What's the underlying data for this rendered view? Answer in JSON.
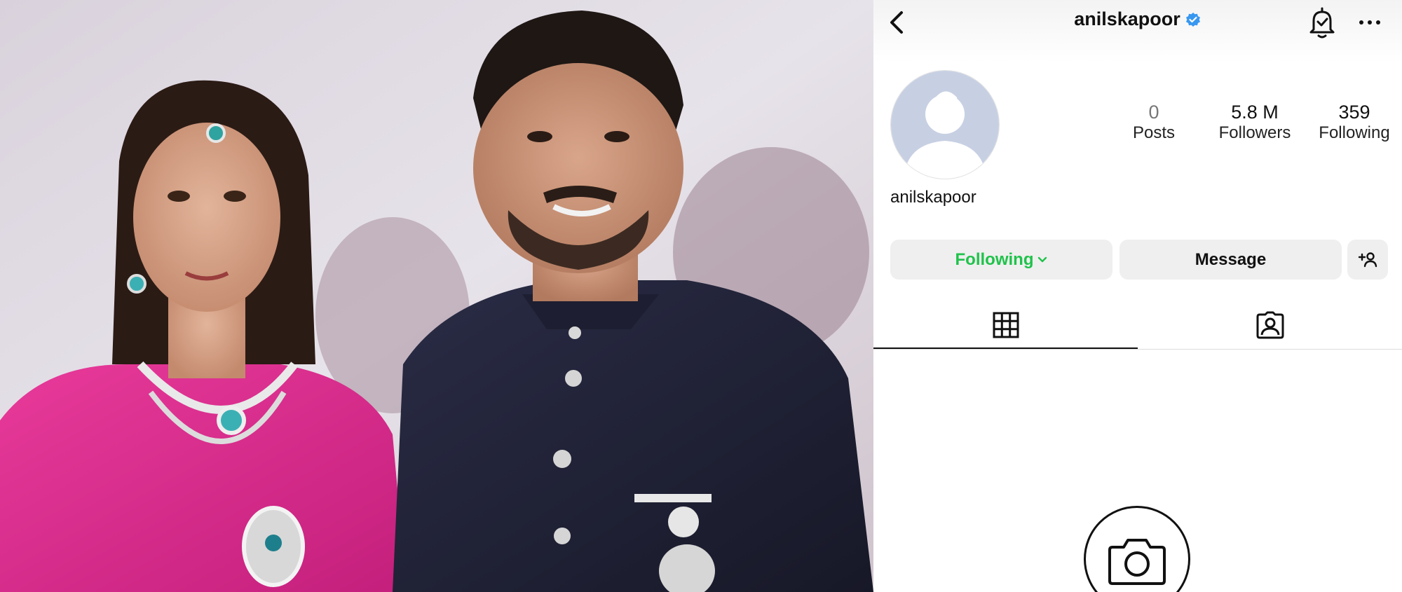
{
  "profile": {
    "username": "anilskapoor",
    "display_name": "anilskapoor",
    "verified": true,
    "stats": [
      {
        "value": "0",
        "label": "Posts"
      },
      {
        "value": "5.8 M",
        "label": "Followers"
      },
      {
        "value": "359",
        "label": "Following"
      }
    ]
  },
  "actions": {
    "following_label": "Following",
    "message_label": "Message"
  },
  "icons": {
    "back": "chevron-left-icon",
    "verified": "verified-badge-icon",
    "notifications": "bell-check-icon",
    "more": "more-horizontal-icon",
    "add_user": "add-user-icon",
    "grid": "grid-icon",
    "tagged": "tagged-user-icon",
    "camera": "camera-icon"
  },
  "colors": {
    "following_green": "#20c24b",
    "verified_blue": "#3897f0",
    "button_gray": "#efefef",
    "avatar_bg": "#c7d0e3"
  }
}
